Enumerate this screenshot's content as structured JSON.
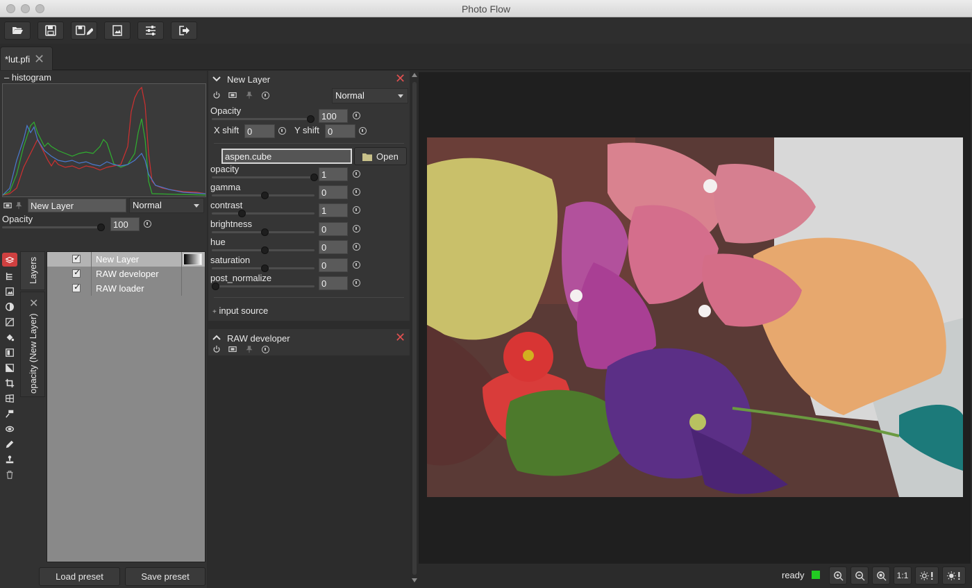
{
  "window": {
    "title": "Photo Flow"
  },
  "toolbar": {
    "buttons": [
      {
        "icon": "folder-open-icon"
      },
      {
        "icon": "save-icon"
      },
      {
        "icon": "save-as-icon"
      },
      {
        "icon": "export-image-icon"
      },
      {
        "icon": "settings-sliders-icon"
      },
      {
        "icon": "exit-icon"
      }
    ]
  },
  "tabs": [
    {
      "label": "*lut.pfi"
    }
  ],
  "histogram": {
    "header": "histogram",
    "collapse_symbol": "–"
  },
  "layer_controls": {
    "layer_name": "New Layer",
    "blend_mode": "Normal",
    "opacity_label": "Opacity",
    "opacity_value": "100",
    "opacity_fraction": 1.0
  },
  "side_tabs": {
    "layers": "Layers",
    "mask": "opacity (New Layer)"
  },
  "layers": [
    {
      "name": "New Layer",
      "checked": true,
      "selected": true
    },
    {
      "name": "RAW developer",
      "checked": true,
      "selected": false
    },
    {
      "name": "RAW loader",
      "checked": true,
      "selected": false
    }
  ],
  "presets": {
    "load": "Load preset",
    "save": "Save preset"
  },
  "node_new_layer": {
    "title": "New Layer",
    "blend_mode": "Normal",
    "opacity_label": "Opacity",
    "opacity_value": "100",
    "xshift_label": "X shift",
    "xshift_value": "0",
    "yshift_label": "Y shift",
    "yshift_value": "0",
    "file_value": "aspen.cube",
    "open_label": "Open",
    "params": [
      {
        "label": "opacity",
        "value": "1",
        "fraction": 1.0
      },
      {
        "label": "gamma",
        "value": "0",
        "fraction": 0.5
      },
      {
        "label": "contrast",
        "value": "1",
        "fraction": 0.27
      },
      {
        "label": "brightness",
        "value": "0",
        "fraction": 0.5
      },
      {
        "label": "hue",
        "value": "0",
        "fraction": 0.5
      },
      {
        "label": "saturation",
        "value": "0",
        "fraction": 0.5
      },
      {
        "label": "post_normalize",
        "value": "0",
        "fraction": 0.0
      }
    ],
    "input_source_label": "input source",
    "input_source_symbol": "+"
  },
  "node_raw_developer": {
    "title": "RAW developer"
  },
  "status": {
    "text": "ready",
    "indicator_color": "#22cc22",
    "one_to_one": "1:1"
  }
}
